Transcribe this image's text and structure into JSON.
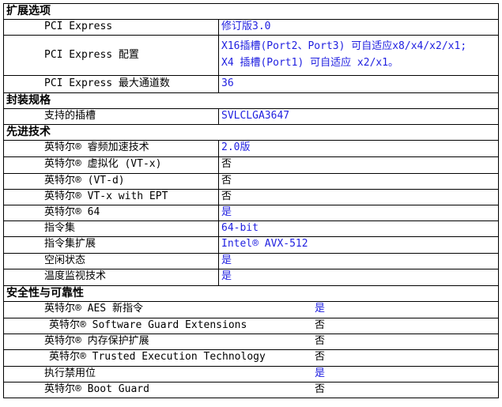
{
  "sections": {
    "expansion": "扩展选项",
    "package": "封装规格",
    "advanced": "先进技术",
    "security": "安全性与可靠性"
  },
  "rows": [
    {
      "label": "PCI Express",
      "value": "修订版3.0",
      "color": "blue"
    },
    {
      "label": "PCI Express 配置",
      "value": "X16插槽(Port2、Port3) 可自适应x8/x4/x2/x1;",
      "value2": "X4 插槽(Port1) 可自适应 x2/x1。",
      "color": "blue"
    },
    {
      "label": "PCI Express 最大通道数",
      "value": "36",
      "color": "blue"
    },
    {
      "label": "支持的插槽",
      "value": "SVLCLGA3647",
      "color": "blue"
    },
    {
      "label": "英特尔® 睿频加速技术",
      "value": "2.0版",
      "color": "blue"
    },
    {
      "label": "英特尔® 虚拟化 (VT-x)",
      "value": "否",
      "color": "black"
    },
    {
      "label": "英特尔® (VT-d)",
      "value": "否",
      "color": "black"
    },
    {
      "label": "英特尔® VT-x with EPT",
      "value": "否",
      "color": "black"
    },
    {
      "label": "英特尔® 64",
      "value": "是",
      "color": "blue"
    },
    {
      "label": "指令集",
      "value": "64-bit",
      "color": "blue"
    },
    {
      "label": "指令集扩展",
      "value": "Intel® AVX-512",
      "color": "blue"
    },
    {
      "label": "空闲状态",
      "value": "是",
      "color": "blue"
    },
    {
      "label": "温度监视技术",
      "value": "是",
      "color": "blue"
    },
    {
      "label": "英特尔® AES 新指令",
      "value": "是",
      "color": "blue"
    },
    {
      "label": "英特尔® Software Guard Extensions",
      "value": "否",
      "color": "black"
    },
    {
      "label": "英特尔® 内存保护扩展",
      "value": "否",
      "color": "black"
    },
    {
      "label": "英特尔® Trusted Execution Technology",
      "value": "否",
      "color": "black"
    },
    {
      "label": "执行禁用位",
      "value": "是",
      "color": "blue"
    },
    {
      "label": "英特尔® Boot Guard",
      "value": "否",
      "color": "black"
    }
  ],
  "colors": {
    "blue": "#1f1fe0",
    "black": "#000000",
    "border": "#000000"
  }
}
